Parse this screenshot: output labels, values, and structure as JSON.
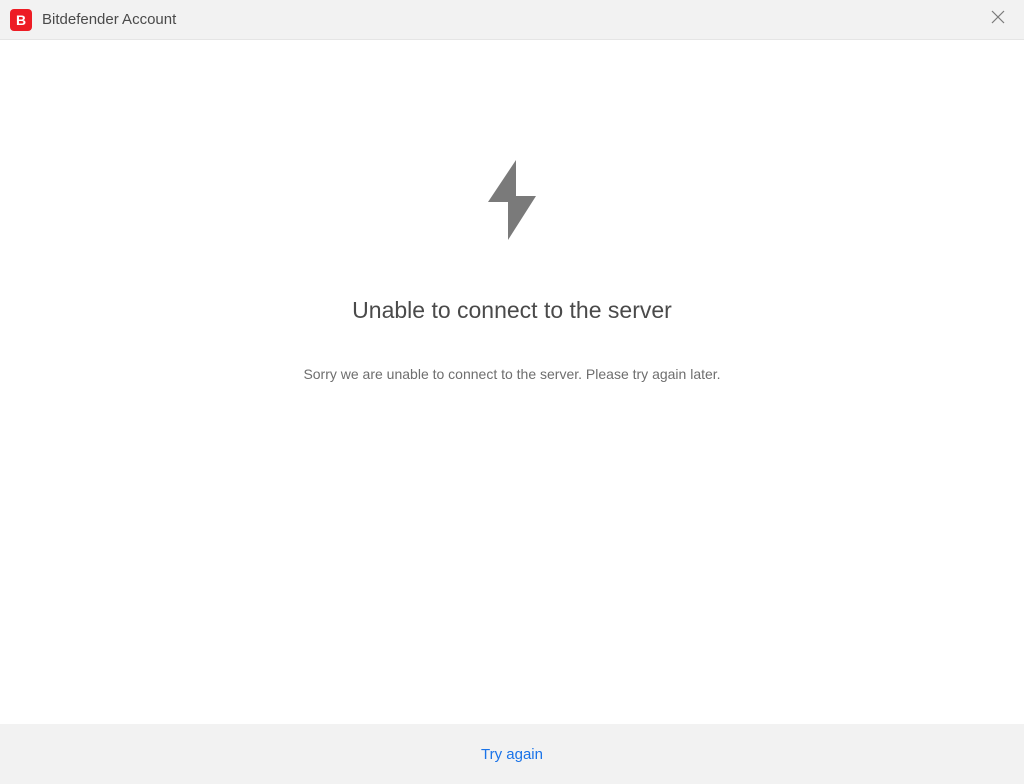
{
  "titlebar": {
    "app_icon_letter": "B",
    "title": "Bitdefender Account"
  },
  "content": {
    "heading": "Unable to connect to the server",
    "subtext": "Sorry we are unable to connect to the server. Please try again later."
  },
  "footer": {
    "try_again_label": "Try again"
  },
  "icons": {
    "bolt": "bolt-icon",
    "close": "close-icon",
    "app": "bitdefender-icon"
  },
  "colors": {
    "brand_red": "#ed1c24",
    "link_blue": "#1a73e8",
    "bg_gray": "#f2f2f2",
    "text_dark": "#4a4a4a",
    "text_muted": "#6e6e6e",
    "icon_gray": "#7a7a7a"
  }
}
